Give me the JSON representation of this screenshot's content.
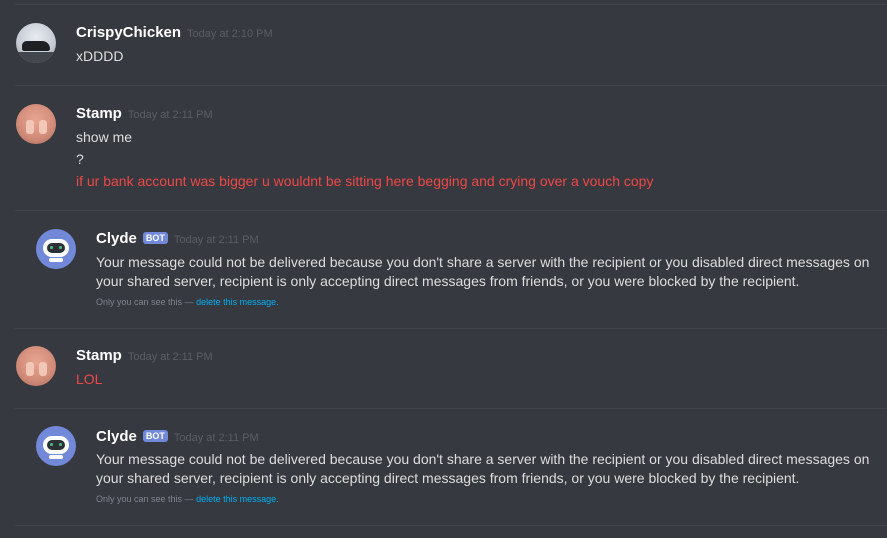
{
  "messages": [
    {
      "author": "CrispyChicken",
      "timestamp": "Today at 2:10 PM",
      "avatar_icon": "motorcycle-avatar",
      "lines": [
        "xDDDD"
      ]
    },
    {
      "author": "Stamp",
      "timestamp": "Today at 2:11 PM",
      "avatar_icon": "hands-avatar",
      "lines": [
        "show me",
        "?",
        "if ur bank account was bigger u wouldnt be sitting here begging and crying over a vouch copy"
      ]
    },
    {
      "author": "Clyde",
      "bot_tag": "BOT",
      "timestamp": "Today at 2:11 PM",
      "avatar_icon": "clyde-robot-avatar",
      "text": "Your message could not be delivered because you don't share a server with the recipient or you disabled direct messages on your shared server, recipient is only accepting direct messages from friends, or you were blocked by the recipient.",
      "ephemeral_note": "Only you can see this —",
      "ephemeral_link": "delete this message."
    },
    {
      "author": "Stamp",
      "timestamp": "Today at 2:11 PM",
      "avatar_icon": "hands-avatar",
      "lines": [
        "LOL"
      ]
    },
    {
      "author": "Clyde",
      "bot_tag": "BOT",
      "timestamp": "Today at 2:11 PM",
      "avatar_icon": "clyde-robot-avatar",
      "text": "Your message could not be delivered because you don't share a server with the recipient or you disabled direct messages on your shared server, recipient is only accepting direct messages from friends, or you were blocked by the recipient.",
      "ephemeral_note": "Only you can see this —",
      "ephemeral_link": "delete this message."
    }
  ],
  "colors": {
    "background": "#36393f",
    "username": "#ffffff",
    "message_text": "#dcddde",
    "red_text": "#f04747",
    "bot_tag": "#7289da",
    "link": "#00b0f4"
  }
}
